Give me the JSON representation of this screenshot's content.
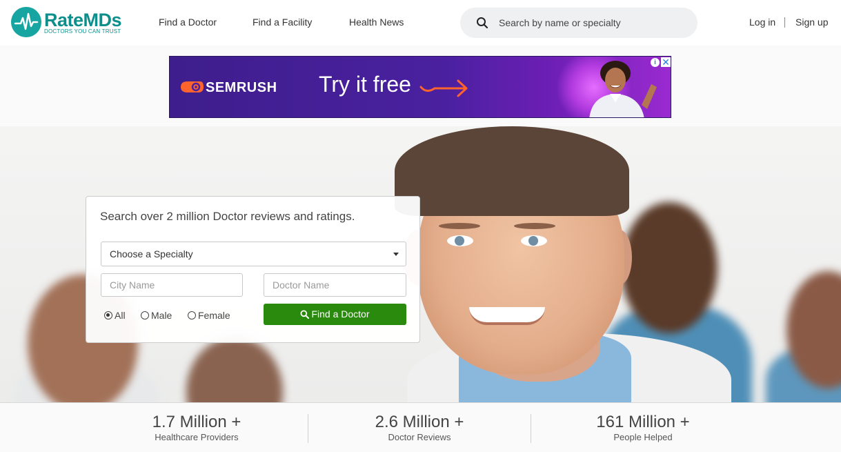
{
  "header": {
    "logo_text": "RateMDs",
    "logo_tagline": "DOCTORS YOU CAN TRUST",
    "nav": [
      "Find a Doctor",
      "Find a Facility",
      "Health News"
    ],
    "search_placeholder": "Search by name or specialty",
    "login": "Log in",
    "signup": "Sign up"
  },
  "ad": {
    "brand": "SEMRUSH",
    "cta": "Try it free",
    "info": "i",
    "close": "✕"
  },
  "search_card": {
    "title": "Search over 2 million Doctor reviews and ratings.",
    "specialty_value": "Choose a Specialty",
    "city_placeholder": "City Name",
    "doctor_placeholder": "Doctor Name",
    "gender_options": [
      "All",
      "Male",
      "Female"
    ],
    "gender_selected": "All",
    "button": "Find a Doctor"
  },
  "stats": [
    {
      "value": "1.7 Million +",
      "label": "Healthcare Providers"
    },
    {
      "value": "2.6 Million +",
      "label": "Doctor Reviews"
    },
    {
      "value": "161 Million +",
      "label": "People Helped"
    }
  ],
  "colors": {
    "brand_teal": "#16a5a0",
    "button_green": "#2a8a0e",
    "ad_purple": "#4a20a0",
    "ad_orange": "#ff642d"
  }
}
